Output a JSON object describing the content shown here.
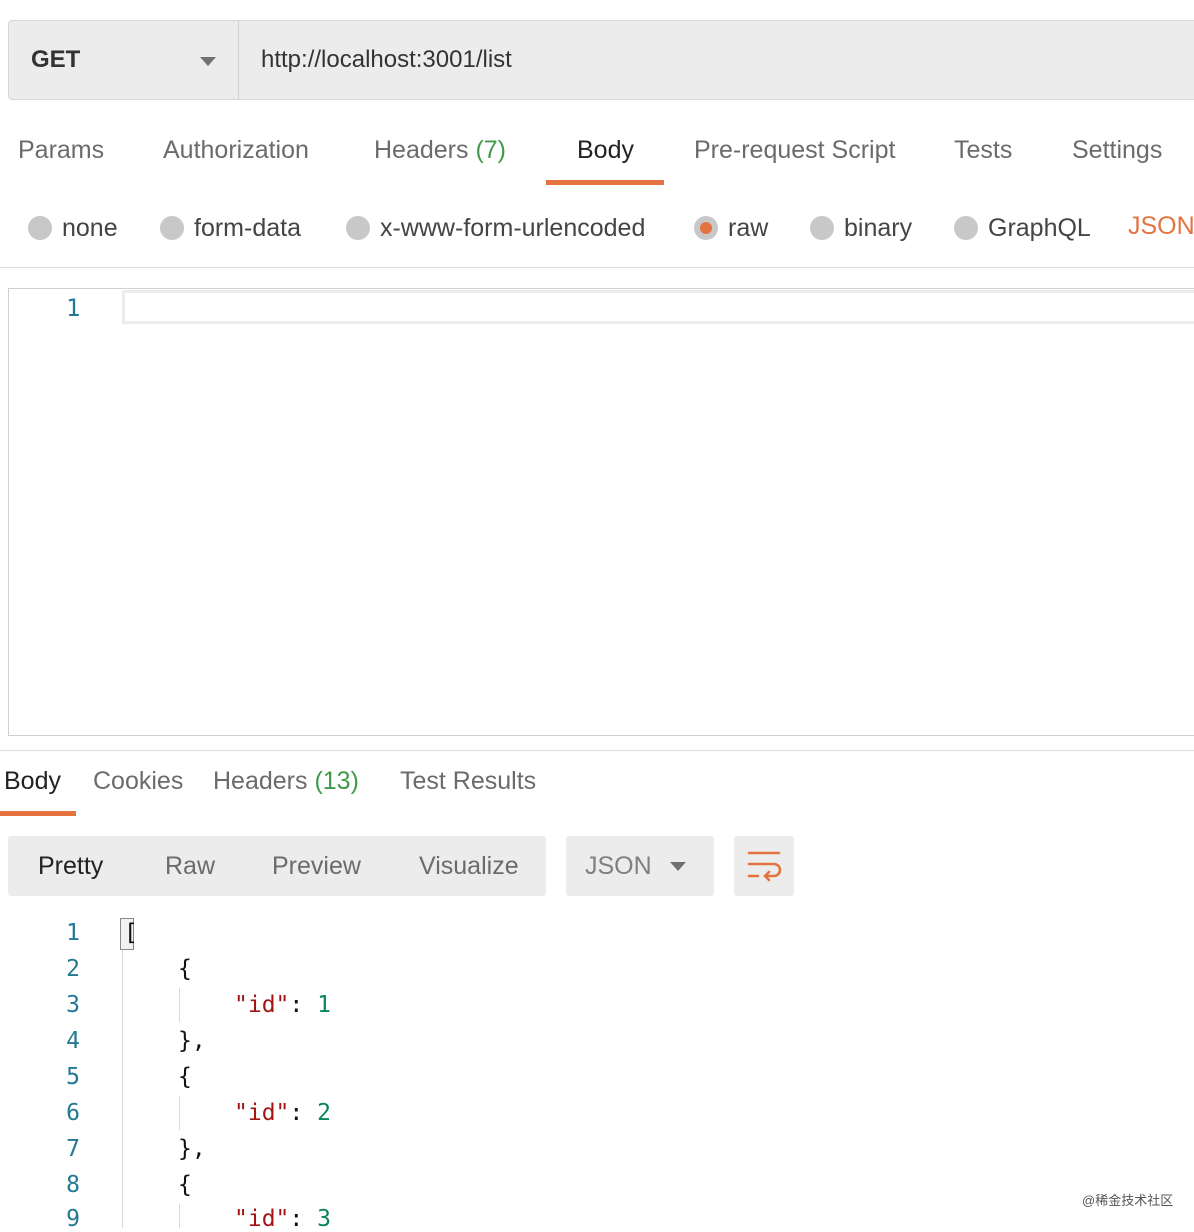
{
  "request": {
    "method": "GET",
    "url": "http://localhost:3001/list"
  },
  "request_tabs": [
    {
      "label": "Params"
    },
    {
      "label": "Authorization"
    },
    {
      "label": "Headers",
      "count": "(7)"
    },
    {
      "label": "Body",
      "active": true
    },
    {
      "label": "Pre-request Script"
    },
    {
      "label": "Tests"
    },
    {
      "label": "Settings"
    }
  ],
  "body_types": [
    {
      "label": "none"
    },
    {
      "label": "form-data"
    },
    {
      "label": "x-www-form-urlencoded"
    },
    {
      "label": "raw",
      "selected": true
    },
    {
      "label": "binary"
    },
    {
      "label": "GraphQL"
    }
  ],
  "body_format": "JSON",
  "request_editor": {
    "line_numbers": [
      "1"
    ]
  },
  "response_tabs": [
    {
      "label": "Body",
      "active": true
    },
    {
      "label": "Cookies"
    },
    {
      "label": "Headers",
      "count": "(13)"
    },
    {
      "label": "Test Results"
    }
  ],
  "response_views": [
    {
      "label": "Pretty",
      "active": true
    },
    {
      "label": "Raw"
    },
    {
      "label": "Preview"
    },
    {
      "label": "Visualize"
    }
  ],
  "response_format": "JSON",
  "response_code": [
    {
      "n": "1",
      "text": "["
    },
    {
      "n": "2",
      "text": "{"
    },
    {
      "n": "3",
      "key": "\"id\"",
      "sep": ": ",
      "value": "1"
    },
    {
      "n": "4",
      "text": "},"
    },
    {
      "n": "5",
      "text": "{"
    },
    {
      "n": "6",
      "key": "\"id\"",
      "sep": ": ",
      "value": "2"
    },
    {
      "n": "7",
      "text": "},"
    },
    {
      "n": "8",
      "text": "{"
    },
    {
      "n": "9",
      "key": "\"id\"",
      "sep": ": ",
      "value": "3"
    }
  ],
  "watermark": "@稀金技术社区",
  "colors": {
    "accent": "#e4733f",
    "count": "#3f9b4b",
    "line_number": "#237893",
    "json_key": "#a31515",
    "json_number": "#098658"
  }
}
